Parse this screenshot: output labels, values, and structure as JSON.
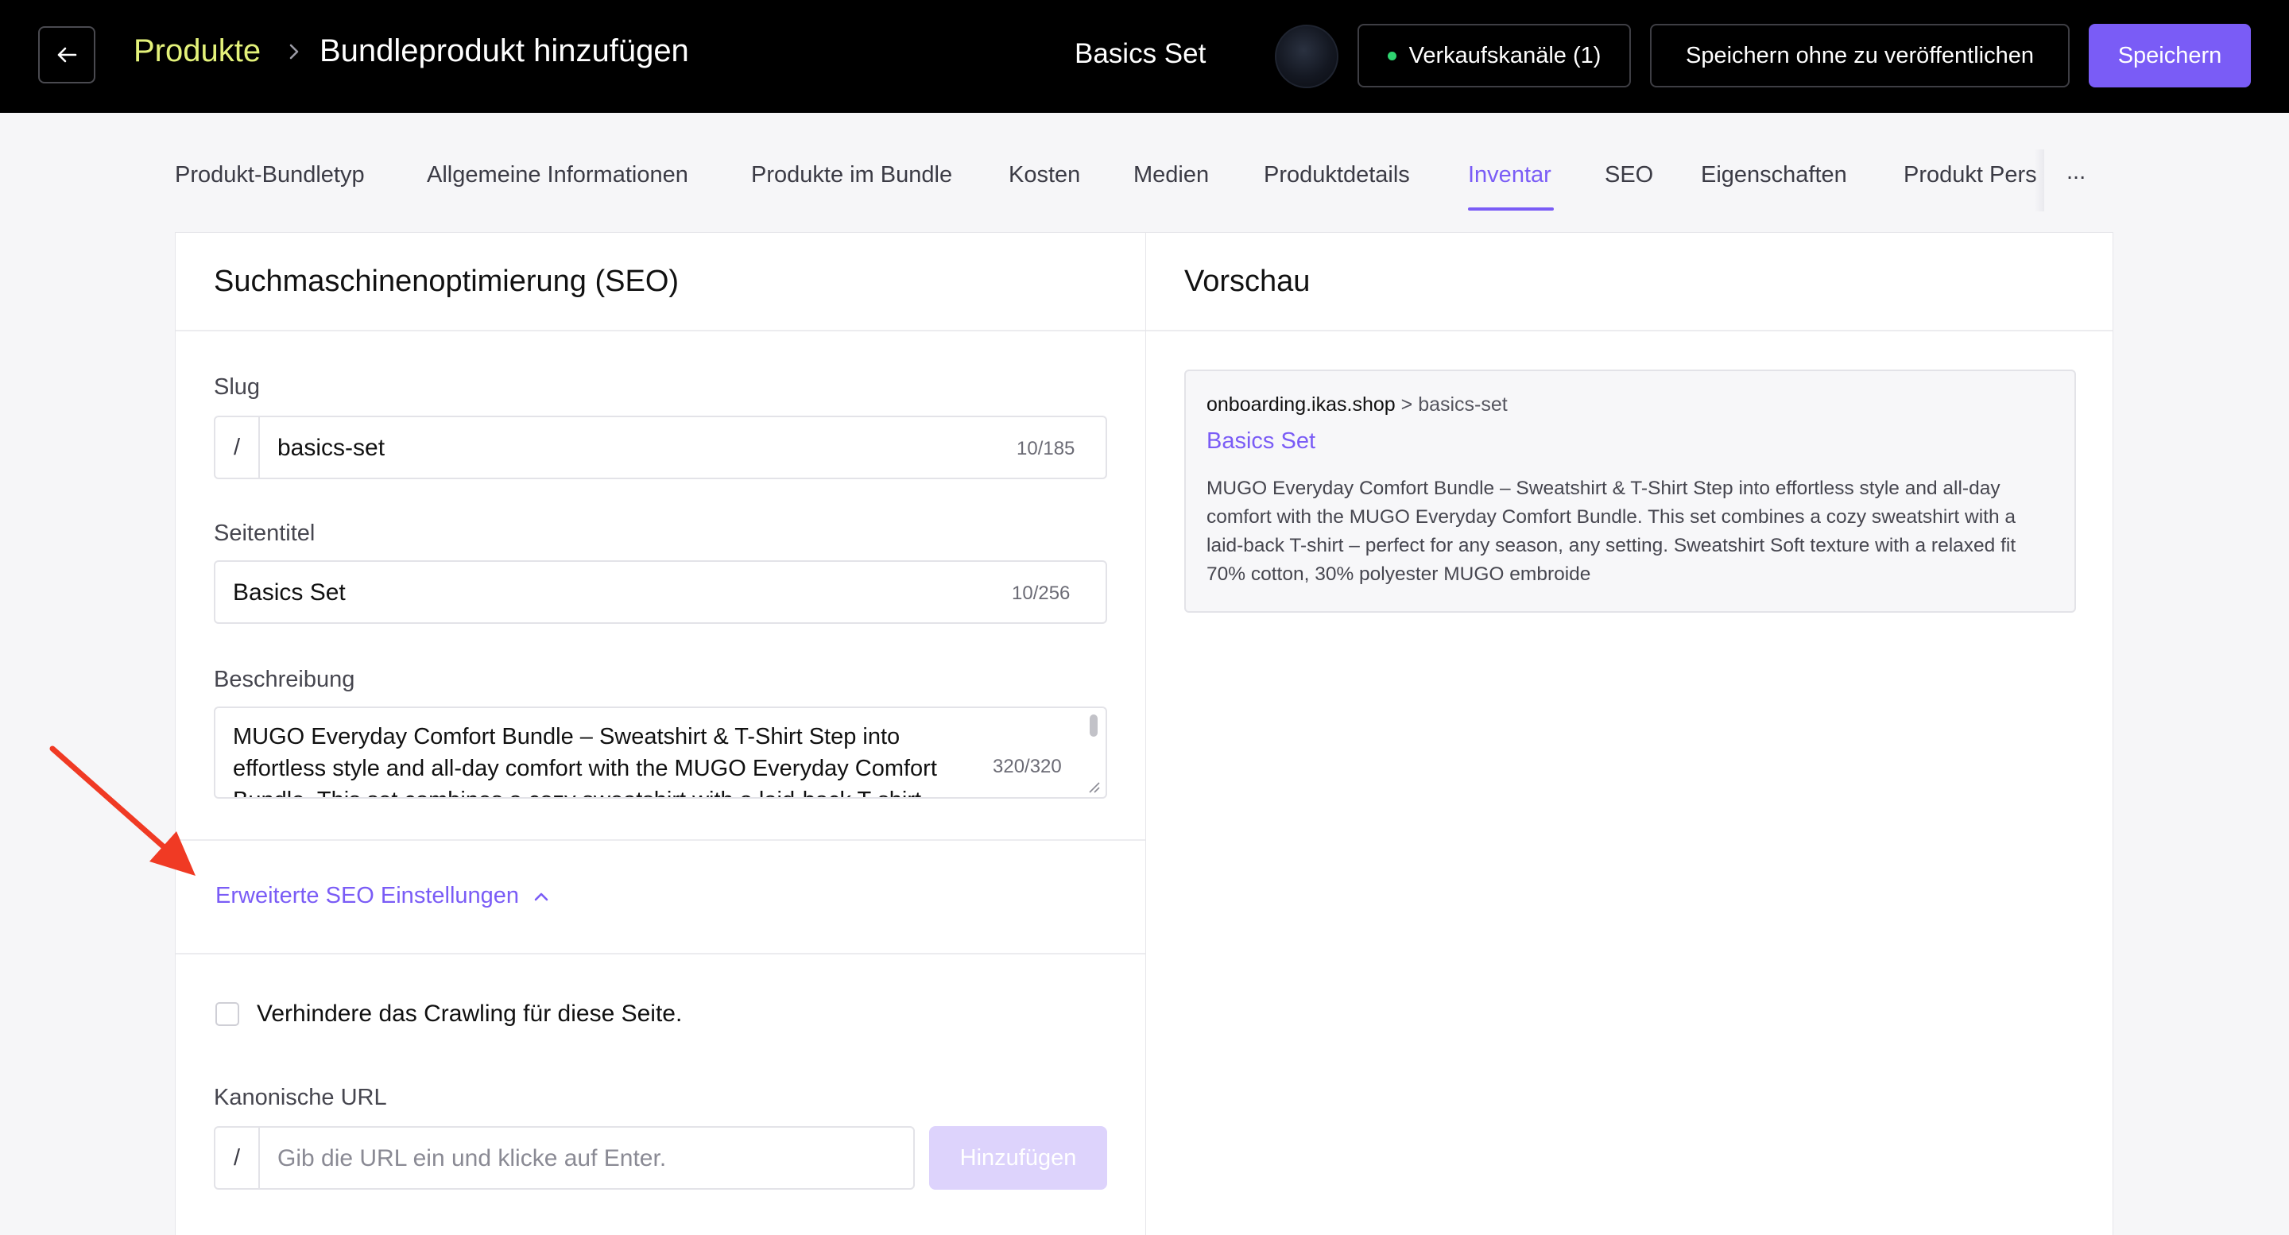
{
  "header": {
    "breadcrumb_parent": "Produkte",
    "breadcrumb_current": "Bundleprodukt hinzufügen",
    "product_name": "Basics Set",
    "sales_channels_label": "Verkaufskanäle (1)",
    "save_draft_label": "Speichern ohne zu veröffentlichen",
    "save_label": "Speichern",
    "icons": {
      "back": "arrow-left-icon",
      "separator": "chevron-right-icon",
      "status": "green-dot-icon"
    }
  },
  "tabs": [
    {
      "label": "Produkt-Bundletyp",
      "active": false
    },
    {
      "label": "Allgemeine Informationen",
      "active": false
    },
    {
      "label": "Produkte im Bundle",
      "active": false
    },
    {
      "label": "Kosten",
      "active": false
    },
    {
      "label": "Medien",
      "active": false
    },
    {
      "label": "Produktdetails",
      "active": false
    },
    {
      "label": "Inventar",
      "active": true
    },
    {
      "label": "SEO",
      "active": false
    },
    {
      "label": "Eigenschaften",
      "active": false
    },
    {
      "label": "Produkt Pers",
      "active": false
    }
  ],
  "tabs_more": "...",
  "seo": {
    "title": "Suchmaschinenoptimierung (SEO)",
    "slug": {
      "label": "Slug",
      "prefix": "/",
      "value": "basics-set",
      "counter": "10/185"
    },
    "page_title": {
      "label": "Seitentitel",
      "value": "Basics Set",
      "counter": "10/256"
    },
    "description": {
      "label": "Beschreibung",
      "value": "MUGO Everyday Comfort Bundle – Sweatshirt & T-Shirt Step into effortless style and all-day comfort with the MUGO Everyday Comfort Bundle. This set combines a cozy sweatshirt with a laid-back T-shirt",
      "counter": "320/320"
    },
    "advanced_toggle": "Erweiterte SEO Einstellungen",
    "prevent_crawling_label": "Verhindere das Crawling für diese Seite.",
    "prevent_crawling_checked": false,
    "canonical": {
      "label": "Kanonische URL",
      "prefix": "/",
      "placeholder": "Gib die URL ein und klicke auf Enter.",
      "add_label": "Hinzufügen"
    }
  },
  "preview": {
    "title": "Vorschau",
    "domain": "onboarding.ikas.shop",
    "separator": ">",
    "path": "basics-set",
    "page_title": "Basics Set",
    "description": "MUGO Everyday Comfort Bundle – Sweatshirt & T-Shirt Step into effortless style and all-day comfort with the MUGO Everyday Comfort Bundle. This set combines a cozy sweatshirt with a laid-back T-shirt – perfect for any season, any setting. Sweatshirt Soft texture with a relaxed fit 70% cotton, 30% polyester MUGO embroide"
  },
  "colors": {
    "accent": "#7a5cf6",
    "breadcrumb_parent": "#e4f27a",
    "status_dot": "#2fd470",
    "annotation_arrow": "#f03a24"
  }
}
